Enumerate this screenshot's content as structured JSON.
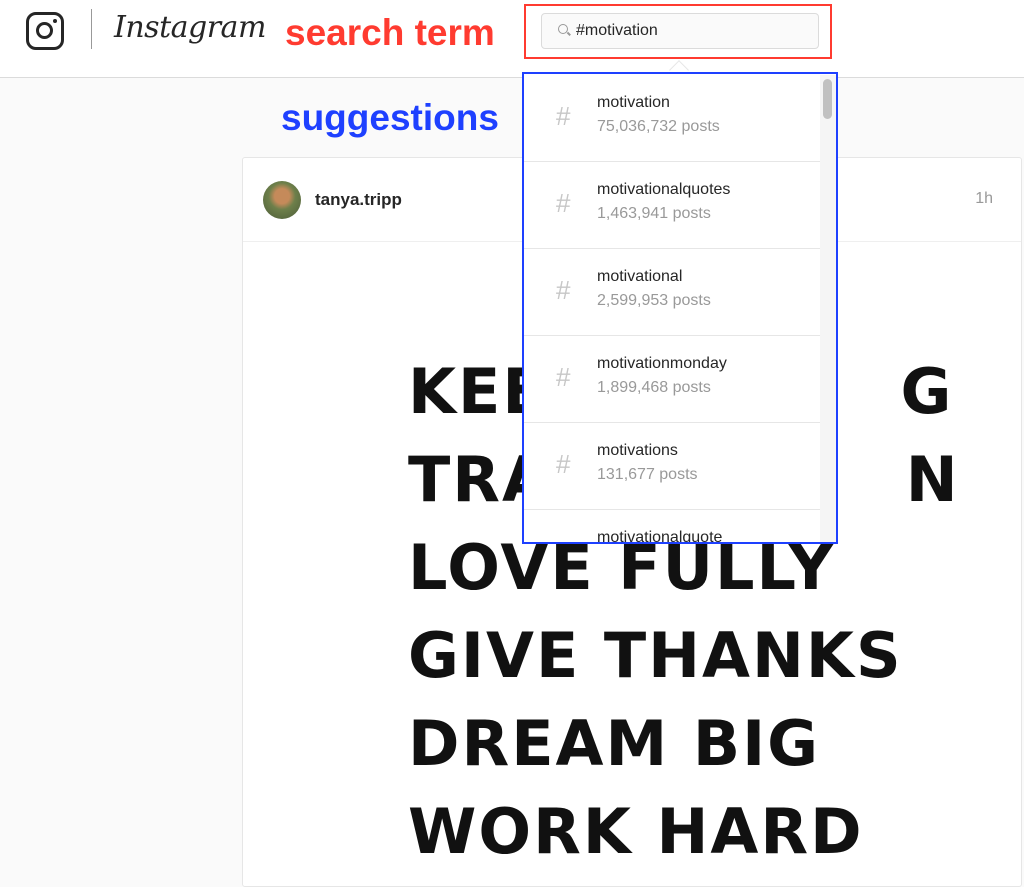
{
  "header": {
    "brand": "Instagram",
    "search_value": "#motivation"
  },
  "annotations": {
    "search_term": "search term",
    "suggestions": "suggestions",
    "colors": {
      "search_term": "#ff3b30",
      "suggestions": "#1e40ff"
    }
  },
  "suggestions": [
    {
      "tag": "motivation",
      "count": "75,036,732 posts"
    },
    {
      "tag": "motivationalquotes",
      "count": "1,463,941 posts"
    },
    {
      "tag": "motivational",
      "count": "2,599,953 posts"
    },
    {
      "tag": "motivationmonday",
      "count": "1,899,468 posts"
    },
    {
      "tag": "motivations",
      "count": "131,677 posts"
    },
    {
      "tag": "motivationalquote",
      "count": ""
    }
  ],
  "post": {
    "username": "tanya.tripp",
    "time": "1h",
    "image_lines": [
      "KEE               G",
      "TRA               N",
      "LOVE FULLY",
      "GIVE THANKS",
      "DREAM BIG",
      "WORK HARD"
    ]
  }
}
